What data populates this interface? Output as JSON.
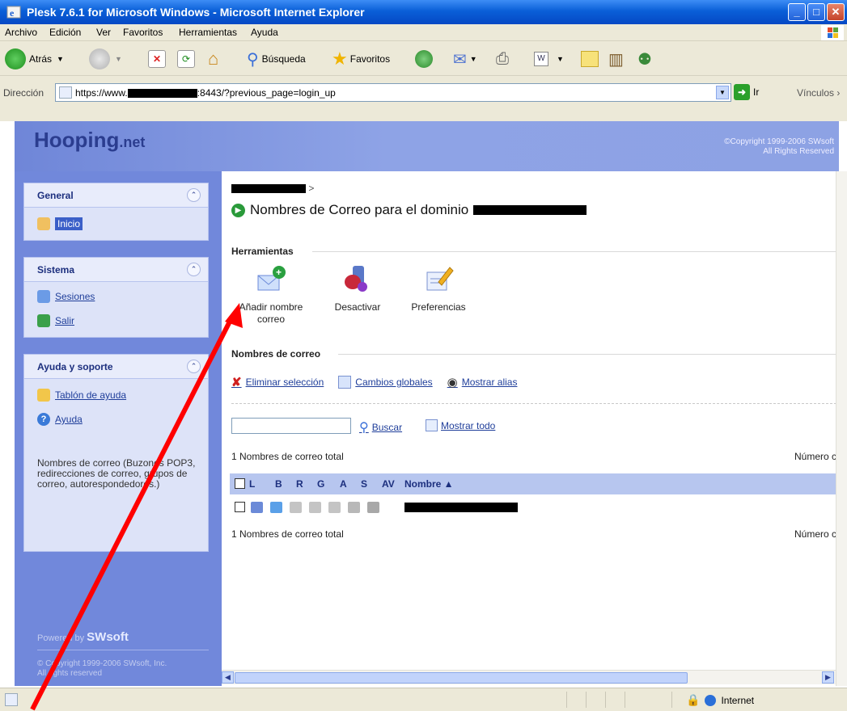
{
  "window": {
    "title": "Plesk 7.6.1 for Microsoft Windows - Microsoft Internet Explorer",
    "controls": [
      "minimize",
      "maximize",
      "close"
    ]
  },
  "menubar": {
    "items": [
      "Archivo",
      "Edición",
      "Ver",
      "Favoritos",
      "Herramientas",
      "Ayuda"
    ]
  },
  "toolbar": {
    "back_label": "Atrás",
    "search_label": "Búsqueda",
    "favorites_label": "Favoritos"
  },
  "address_bar": {
    "label": "Dirección",
    "url_prefix": "https://www.",
    "url_suffix": ":8443/?previous_page=login_up",
    "go_label": "Ir",
    "links_label": "Vínculos"
  },
  "banner": {
    "logo_main": "Hooping",
    "logo_tld": ".net",
    "copyright_line1": "©Copyright 1999-2006 SWsoft",
    "copyright_line2": "All Rights Reserved"
  },
  "sidebar": {
    "general": {
      "title": "General",
      "items": [
        "Inicio"
      ]
    },
    "sistema": {
      "title": "Sistema",
      "items": [
        "Sesiones",
        "Salir"
      ]
    },
    "ayuda": {
      "title": "Ayuda y soporte",
      "items": [
        "Tablón de ayuda",
        "Ayuda"
      ],
      "help_text": "Nombres de correo (Buzones POP3, redirecciones de correo, grupos de correo, autorespondedores.)"
    },
    "powered_by": "Powered by",
    "powered_brand": "SWsoft",
    "footer_line1": "© Copyright 1999-2006 SWsoft, Inc.",
    "footer_line2": "All rights reserved"
  },
  "content": {
    "breadcrumb_sep": ">",
    "page_title": "Nombres de Correo para el dominio",
    "tools_title": "Herramientas",
    "tools": [
      {
        "label_line1": "Añadir nombre",
        "label_line2": "correo",
        "icon": "add-mail-icon"
      },
      {
        "label_line1": "Desactivar",
        "label_line2": "",
        "icon": "deactivate-icon"
      },
      {
        "label_line1": "Preferencias",
        "label_line2": "",
        "icon": "preferences-icon"
      }
    ],
    "mail_names_title": "Nombres de correo",
    "actions": [
      "Eliminar selección",
      "Cambios globales",
      "Mostrar alias"
    ],
    "search_placeholder": "",
    "search_label": "Buscar",
    "show_all_label": "Mostrar todo",
    "total_text": "1 Nombres de correo total",
    "number_label": "Número c",
    "table": {
      "columns": [
        "L",
        "B",
        "R",
        "G",
        "A",
        "S",
        "AV",
        "Nombre ▲"
      ]
    }
  },
  "statusbar": {
    "zone_label": "Internet"
  },
  "colors": {
    "xp_title": "#0a5fd8",
    "sidebar_bg": "#7188db",
    "panel_bg": "#dde3f8",
    "table_head": "#b7c6ef",
    "annotation_arrow": "#ff0000"
  }
}
